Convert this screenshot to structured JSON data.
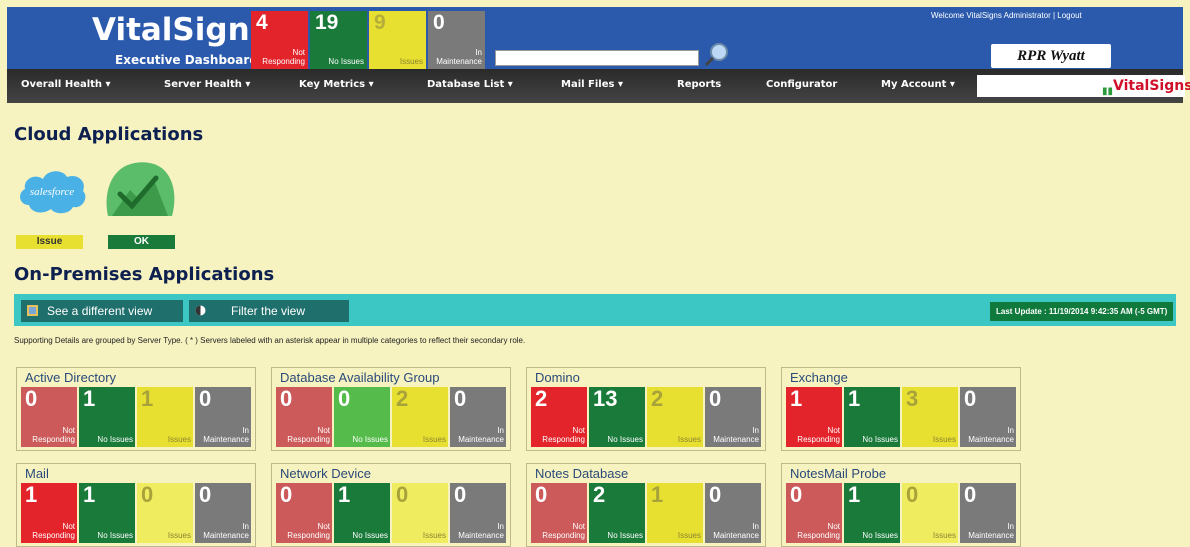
{
  "header": {
    "app_title": "VitalSigns",
    "subtitle": "Executive Dashboard",
    "tiles": [
      {
        "count": "4",
        "label_line1": "Not",
        "label_line2": "Responding",
        "color": "#e3242b"
      },
      {
        "count": "19",
        "label_line1": "",
        "label_line2": "No Issues",
        "color": "#1a7a3a"
      },
      {
        "count": "9",
        "label_line1": "",
        "label_line2": "Issues",
        "color": "#e8e030"
      },
      {
        "count": "0",
        "label_line1": "In",
        "label_line2": "Maintenance",
        "color": "#7a7a7a"
      }
    ],
    "search": {
      "value": "",
      "placeholder": ""
    },
    "welcome": "Welcome VitalSigns Administrator | Logout",
    "client_logo_text": "RPR Wyatt"
  },
  "nav": {
    "items": [
      {
        "label": "Overall Health ▾"
      },
      {
        "label": "Server Health ▾"
      },
      {
        "label": "Key Metrics ▾"
      },
      {
        "label": "Database List ▾"
      },
      {
        "label": "Mail Files ▾"
      },
      {
        "label": "Reports"
      },
      {
        "label": "Configurator"
      },
      {
        "label": "My Account ▾"
      }
    ],
    "brand_logo": "VitalSigns"
  },
  "cloud": {
    "heading": "Cloud Applications",
    "apps": [
      {
        "icon": "salesforce-icon",
        "logo_text": "salesforce",
        "status": "Issue",
        "status_color": "#e8e030"
      },
      {
        "icon": "mountain-cloud-icon",
        "status": "OK",
        "status_color": "#1a7a3a"
      }
    ]
  },
  "onprem": {
    "heading": "On-Premises Applications",
    "toolbar": {
      "view_button": "See a different view",
      "filter_button": "Filter the view",
      "last_update": "Last Update : 11/19/2014 9:42:35 AM  (-5 GMT)"
    },
    "note": "Supporting Details are grouped by Server Type. ( * ) Servers labeled with an asterisk appear in multiple categories to reflect their secondary role.",
    "groups": [
      {
        "title": "Active Directory",
        "counts": [
          "0",
          "1",
          "1",
          "0"
        ],
        "colors": [
          "#cc5a5a",
          "#1a7a3a",
          "#e8e030",
          "#7a7a7a"
        ]
      },
      {
        "title": "Database Availability Group",
        "counts": [
          "0",
          "0",
          "2",
          "0"
        ],
        "colors": [
          "#cc5a5a",
          "#55bb4a",
          "#e8e030",
          "#7a7a7a"
        ]
      },
      {
        "title": "Domino",
        "counts": [
          "2",
          "13",
          "2",
          "0"
        ],
        "colors": [
          "#e3242b",
          "#1a7a3a",
          "#e8e030",
          "#7a7a7a"
        ]
      },
      {
        "title": "Exchange",
        "counts": [
          "1",
          "1",
          "3",
          "0"
        ],
        "colors": [
          "#e3242b",
          "#1a7a3a",
          "#e8e030",
          "#7a7a7a"
        ]
      },
      {
        "title": "Mail",
        "counts": [
          "1",
          "1",
          "0",
          "0"
        ],
        "colors": [
          "#e3242b",
          "#1a7a3a",
          "#f0ec60",
          "#7a7a7a"
        ]
      },
      {
        "title": "Network Device",
        "counts": [
          "0",
          "1",
          "0",
          "0"
        ],
        "colors": [
          "#cc5a5a",
          "#1a7a3a",
          "#f0ec60",
          "#7a7a7a"
        ]
      },
      {
        "title": "Notes Database",
        "counts": [
          "0",
          "2",
          "1",
          "0"
        ],
        "colors": [
          "#cc5a5a",
          "#1a7a3a",
          "#e8e030",
          "#7a7a7a"
        ]
      },
      {
        "title": "NotesMail Probe",
        "counts": [
          "0",
          "1",
          "0",
          "0"
        ],
        "colors": [
          "#cc5a5a",
          "#1a7a3a",
          "#f0ec60",
          "#7a7a7a"
        ]
      }
    ],
    "tile_labels": [
      {
        "line1": "Not",
        "line2": "Responding"
      },
      {
        "line1": "",
        "line2": "No Issues"
      },
      {
        "line1": "",
        "line2": "Issues"
      },
      {
        "line1": "In",
        "line2": "Maintenance"
      }
    ]
  }
}
